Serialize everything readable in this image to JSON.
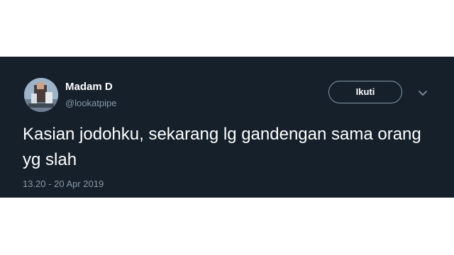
{
  "tweet": {
    "user": {
      "display_name": "Madam D",
      "handle": "@lookatpipe",
      "avatar_icon": "user-avatar"
    },
    "follow_label": "Ikuti",
    "more_icon": "chevron-down-icon",
    "text": "Kasian jodohku, sekarang lg gandengan sama orang yg slah",
    "timestamp": "13.20 - 20 Apr 2019"
  },
  "colors": {
    "card_background": "#15202b",
    "primary_text": "#ffffff",
    "secondary_text": "#8899a6",
    "page_background": "#ffffff"
  }
}
